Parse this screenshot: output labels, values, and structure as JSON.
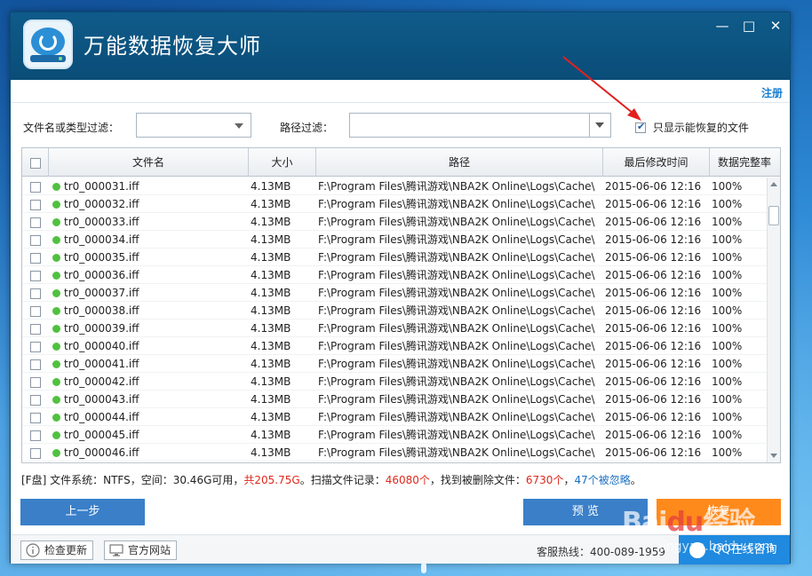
{
  "app": {
    "title": "万能数据恢复大师"
  },
  "window_controls": {
    "minimize": "—",
    "maximize": "□",
    "close": "✕"
  },
  "subbar": {
    "register": "注册"
  },
  "filters": {
    "name_type_label": "文件名或类型过滤：",
    "name_type_value": "",
    "path_label": "路径过滤：",
    "path_value": "",
    "only_recoverable_label": "只显示能恢复的文件",
    "only_recoverable_checked": true
  },
  "table": {
    "headers": {
      "name": "文件名",
      "size": "大小",
      "path": "路径",
      "modified": "最后修改时间",
      "integrity": "数据完整率"
    },
    "rows": [
      {
        "name": "tr0_000031.iff",
        "size": "4.13MB",
        "path": "F:\\Program Files\\腾讯游戏\\NBA2K Online\\Logs\\Cache\\",
        "modified": "2015-06-06   12:16",
        "integrity": "100%"
      },
      {
        "name": "tr0_000032.iff",
        "size": "4.13MB",
        "path": "F:\\Program Files\\腾讯游戏\\NBA2K Online\\Logs\\Cache\\",
        "modified": "2015-06-06   12:16",
        "integrity": "100%"
      },
      {
        "name": "tr0_000033.iff",
        "size": "4.13MB",
        "path": "F:\\Program Files\\腾讯游戏\\NBA2K Online\\Logs\\Cache\\",
        "modified": "2015-06-06   12:16",
        "integrity": "100%"
      },
      {
        "name": "tr0_000034.iff",
        "size": "4.13MB",
        "path": "F:\\Program Files\\腾讯游戏\\NBA2K Online\\Logs\\Cache\\",
        "modified": "2015-06-06   12:16",
        "integrity": "100%"
      },
      {
        "name": "tr0_000035.iff",
        "size": "4.13MB",
        "path": "F:\\Program Files\\腾讯游戏\\NBA2K Online\\Logs\\Cache\\",
        "modified": "2015-06-06   12:16",
        "integrity": "100%"
      },
      {
        "name": "tr0_000036.iff",
        "size": "4.13MB",
        "path": "F:\\Program Files\\腾讯游戏\\NBA2K Online\\Logs\\Cache\\",
        "modified": "2015-06-06   12:16",
        "integrity": "100%"
      },
      {
        "name": "tr0_000037.iff",
        "size": "4.13MB",
        "path": "F:\\Program Files\\腾讯游戏\\NBA2K Online\\Logs\\Cache\\",
        "modified": "2015-06-06   12:16",
        "integrity": "100%"
      },
      {
        "name": "tr0_000038.iff",
        "size": "4.13MB",
        "path": "F:\\Program Files\\腾讯游戏\\NBA2K Online\\Logs\\Cache\\",
        "modified": "2015-06-06   12:16",
        "integrity": "100%"
      },
      {
        "name": "tr0_000039.iff",
        "size": "4.13MB",
        "path": "F:\\Program Files\\腾讯游戏\\NBA2K Online\\Logs\\Cache\\",
        "modified": "2015-06-06   12:16",
        "integrity": "100%"
      },
      {
        "name": "tr0_000040.iff",
        "size": "4.13MB",
        "path": "F:\\Program Files\\腾讯游戏\\NBA2K Online\\Logs\\Cache\\",
        "modified": "2015-06-06   12:16",
        "integrity": "100%"
      },
      {
        "name": "tr0_000041.iff",
        "size": "4.13MB",
        "path": "F:\\Program Files\\腾讯游戏\\NBA2K Online\\Logs\\Cache\\",
        "modified": "2015-06-06   12:16",
        "integrity": "100%"
      },
      {
        "name": "tr0_000042.iff",
        "size": "4.13MB",
        "path": "F:\\Program Files\\腾讯游戏\\NBA2K Online\\Logs\\Cache\\",
        "modified": "2015-06-06   12:16",
        "integrity": "100%"
      },
      {
        "name": "tr0_000043.iff",
        "size": "4.13MB",
        "path": "F:\\Program Files\\腾讯游戏\\NBA2K Online\\Logs\\Cache\\",
        "modified": "2015-06-06   12:16",
        "integrity": "100%"
      },
      {
        "name": "tr0_000044.iff",
        "size": "4.13MB",
        "path": "F:\\Program Files\\腾讯游戏\\NBA2K Online\\Logs\\Cache\\",
        "modified": "2015-06-06   12:16",
        "integrity": "100%"
      },
      {
        "name": "tr0_000045.iff",
        "size": "4.13MB",
        "path": "F:\\Program Files\\腾讯游戏\\NBA2K Online\\Logs\\Cache\\",
        "modified": "2015-06-06   12:16",
        "integrity": "100%"
      },
      {
        "name": "tr0_000046.iff",
        "size": "4.13MB",
        "path": "F:\\Program Files\\腾讯游戏\\NBA2K Online\\Logs\\Cache\\",
        "modified": "2015-06-06   12:16",
        "integrity": "100%"
      }
    ]
  },
  "status": {
    "drive": "[F盘]",
    "fs_text": "文件系统：NTFS，空间：30.46G可用，",
    "total": "共205.75G",
    "scan_prefix": "。扫描文件记录：",
    "records": "46080个",
    "deleted_prefix": "，找到被删除文件：",
    "deleted": "6730个",
    "sep": "，",
    "ignored": "47个被忽略",
    "end": "。"
  },
  "buttons": {
    "prev": "上一步",
    "preview": "预 览",
    "recover": "恢复"
  },
  "bottom": {
    "check_update": "检查更新",
    "website": "官方网站",
    "hotline": "客服热线：400-089-1959",
    "qq_consult": "QQ在线咨询"
  },
  "watermark": {
    "main": "Bai",
    "paw": "du",
    "suffix": "经验",
    "sub": "jingyan.baidu.com"
  },
  "colors": {
    "title_bar": "#0f5b8a",
    "accent_blue": "#3a7fc8",
    "accent_orange": "#ff8a1c",
    "status_red": "#e0281c",
    "status_blue": "#1b6fc2",
    "dot_green": "#4fc13f"
  }
}
